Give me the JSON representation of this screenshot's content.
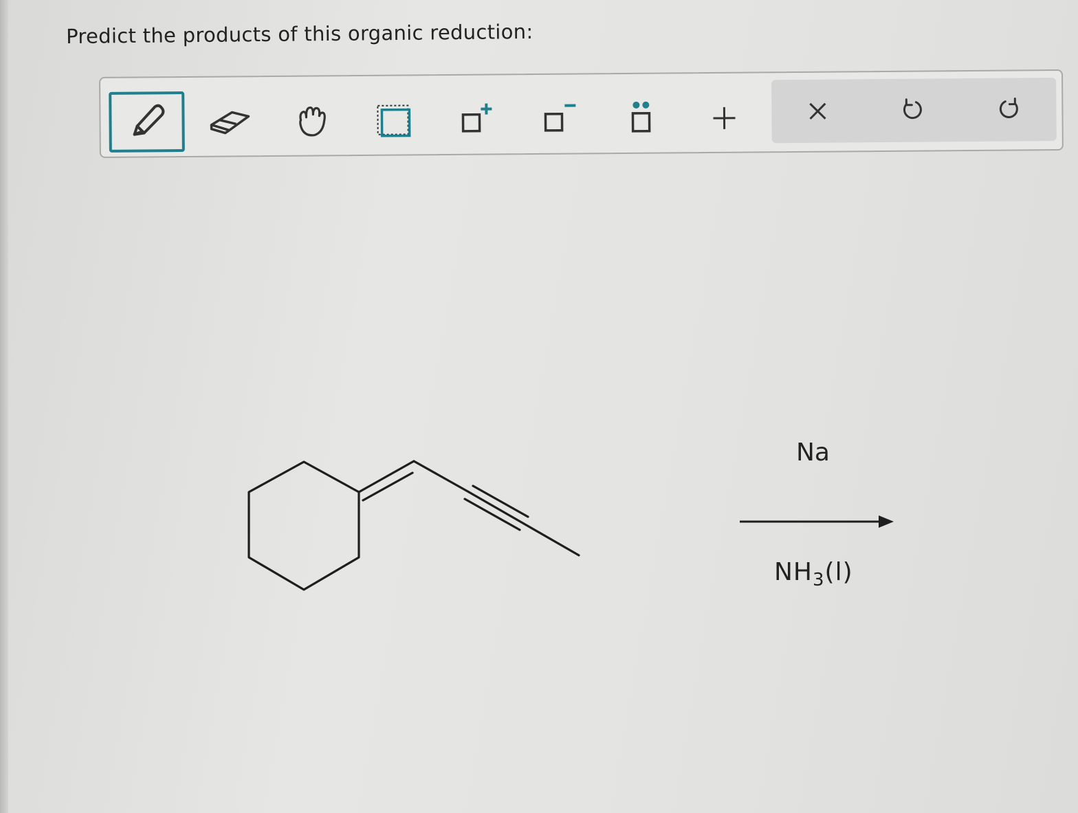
{
  "question": {
    "text": "Predict the products of this organic reduction:"
  },
  "toolbar": {
    "tools": [
      {
        "name": "pencil-icon",
        "active": true
      },
      {
        "name": "eraser-icon",
        "active": false
      },
      {
        "name": "hand-icon",
        "active": false
      },
      {
        "name": "select-box-icon",
        "active": false
      },
      {
        "name": "positive-charge-icon",
        "active": false
      },
      {
        "name": "negative-charge-icon",
        "active": false
      },
      {
        "name": "lone-pair-icon",
        "active": false
      },
      {
        "name": "plus-icon",
        "active": false
      }
    ],
    "actions": [
      {
        "name": "clear-icon"
      },
      {
        "name": "undo-icon"
      },
      {
        "name": "redo-icon"
      }
    ],
    "accent_color": "#1f7f8c"
  },
  "reaction": {
    "reagent_above": "Na",
    "reagent_below_main": "NH",
    "reagent_below_sub": "3",
    "reagent_below_state": "(l)"
  }
}
